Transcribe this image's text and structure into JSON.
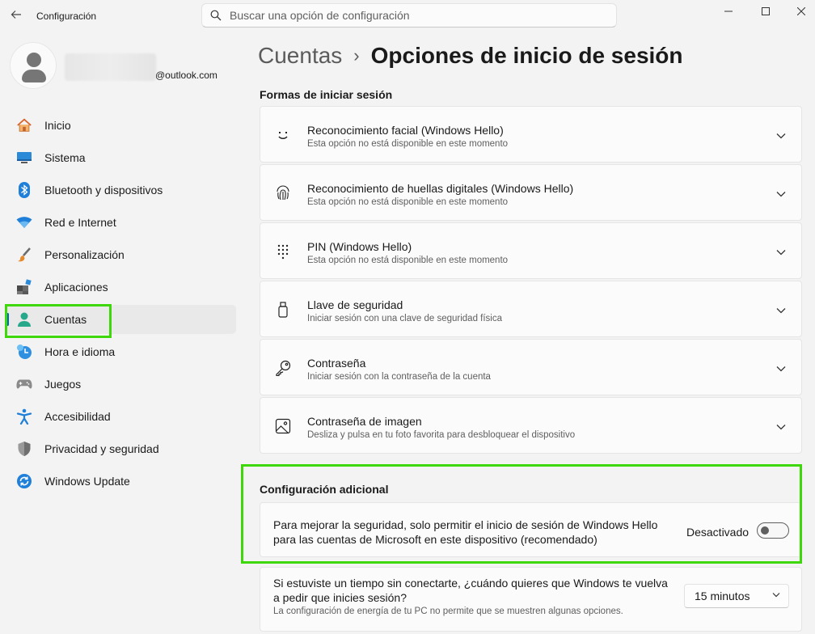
{
  "window": {
    "title": "Configuración"
  },
  "search": {
    "placeholder": "Buscar una opción de configuración"
  },
  "profile": {
    "email": "@outlook.com"
  },
  "sidebar": {
    "items": [
      {
        "label": "Inicio",
        "icon": "home-icon"
      },
      {
        "label": "Sistema",
        "icon": "monitor-icon"
      },
      {
        "label": "Bluetooth y dispositivos",
        "icon": "bluetooth-icon"
      },
      {
        "label": "Red e Internet",
        "icon": "wifi-icon"
      },
      {
        "label": "Personalización",
        "icon": "brush-icon"
      },
      {
        "label": "Aplicaciones",
        "icon": "apps-icon"
      },
      {
        "label": "Cuentas",
        "icon": "person-icon",
        "active": true
      },
      {
        "label": "Hora e idioma",
        "icon": "clock-globe-icon"
      },
      {
        "label": "Juegos",
        "icon": "gamepad-icon"
      },
      {
        "label": "Accesibilidad",
        "icon": "accessibility-icon"
      },
      {
        "label": "Privacidad y seguridad",
        "icon": "shield-icon"
      },
      {
        "label": "Windows Update",
        "icon": "update-icon"
      }
    ]
  },
  "breadcrumb": {
    "parent": "Cuentas",
    "separator": "›",
    "current": "Opciones de inicio de sesión"
  },
  "signin": {
    "section_title": "Formas de iniciar sesión",
    "options": [
      {
        "title": "Reconocimiento facial (Windows Hello)",
        "subtitle": "Esta opción no está disponible en este momento",
        "icon": "face-icon"
      },
      {
        "title": "Reconocimiento de huellas digitales (Windows Hello)",
        "subtitle": "Esta opción no está disponible en este momento",
        "icon": "fingerprint-icon"
      },
      {
        "title": "PIN (Windows Hello)",
        "subtitle": "Esta opción no está disponible en este momento",
        "icon": "pin-keypad-icon"
      },
      {
        "title": "Llave de seguridad",
        "subtitle": "Iniciar sesión con una clave de seguridad física",
        "icon": "usb-key-icon"
      },
      {
        "title": "Contraseña",
        "subtitle": "Iniciar sesión con la contraseña de la cuenta",
        "icon": "key-icon"
      },
      {
        "title": "Contraseña de imagen",
        "subtitle": "Desliza y pulsa en tu foto favorita para desbloquear el dispositivo",
        "icon": "picture-icon"
      }
    ]
  },
  "additional": {
    "section_title": "Configuración adicional",
    "hello_only": {
      "line1": "Para mejorar la seguridad, solo permitir el inicio de sesión de Windows Hello",
      "line2": "para las cuentas de Microsoft en este dispositivo (recomendado)",
      "state_label": "Desactivado",
      "enabled": false
    },
    "reauth": {
      "line1": "Si estuviste un tiempo sin conectarte, ¿cuándo quieres que Windows te vuelva",
      "line2": "a pedir que inicies sesión?",
      "note": "La configuración de energía de tu PC no permite que se muestren algunas opciones.",
      "selected": "15 minutos"
    }
  },
  "colors": {
    "accent": "#0067c0",
    "highlight": "#3ed70a"
  }
}
